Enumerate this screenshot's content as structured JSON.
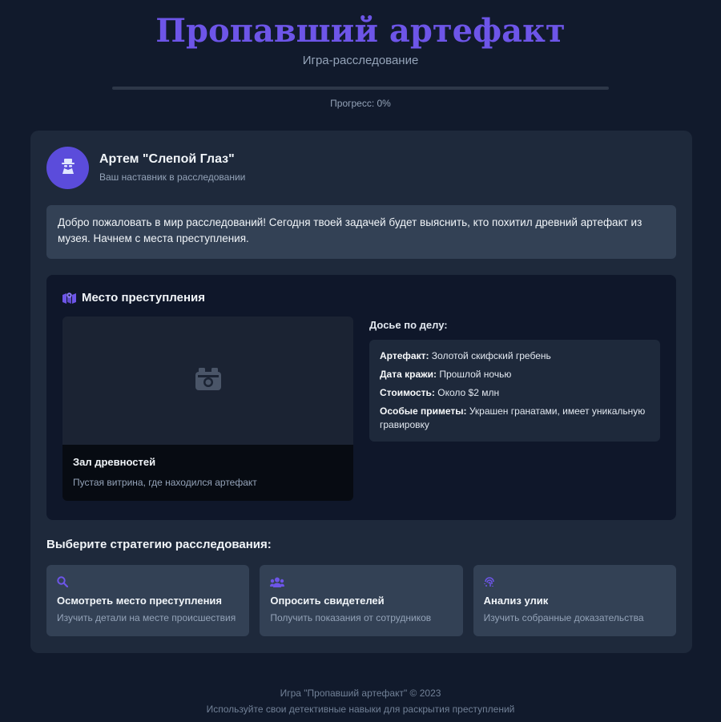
{
  "header": {
    "title": "Пропавший артефакт",
    "subtitle": "Игра-расследование",
    "progress_label": "Прогресс: 0%",
    "progress_value": 0
  },
  "mentor": {
    "avatar_icon": "detective-icon",
    "name": "Артем \"Слепой Глаз\"",
    "role": "Ваш наставник в расследовании"
  },
  "speech": "Добро пожаловать в мир расследований! Сегодня твоей задачей будет выяснить, кто похитил древний артефакт из музея. Начнем с места преступления.",
  "scene": {
    "icon": "map-location-icon",
    "title": "Место преступления",
    "photo_icon": "camera-icon",
    "photo_title": "Зал древностей",
    "photo_desc": "Пустая витрина, где находился артефакт"
  },
  "dossier": {
    "heading": "Досье по делу:",
    "rows": [
      {
        "label": "Артефакт:",
        "value": " Золотой скифский гребень"
      },
      {
        "label": "Дата кражи:",
        "value": " Прошлой ночью"
      },
      {
        "label": "Стоимость:",
        "value": " Около $2 млн"
      },
      {
        "label": "Особые приметы:",
        "value": " Украшен гранатами, имеет уникальную гравировку"
      }
    ]
  },
  "strategy": {
    "heading": "Выберите стратегию расследования:",
    "options": [
      {
        "icon": "search-icon",
        "title": "Осмотреть место преступления",
        "desc": "Изучить детали на месте происшествия"
      },
      {
        "icon": "users-icon",
        "title": "Опросить свидетелей",
        "desc": "Получить показания от сотрудников"
      },
      {
        "icon": "fingerprint-icon",
        "title": "Анализ улик",
        "desc": "Изучить собранные доказательства"
      }
    ]
  },
  "footer": {
    "line1": "Игра \"Пропавший артефакт\" © 2023",
    "line2": "Используйте свои детективные навыки для раскрытия преступлений"
  },
  "colors": {
    "accent": "#6d55e8",
    "background": "#111a2c",
    "card": "#1e293b"
  }
}
